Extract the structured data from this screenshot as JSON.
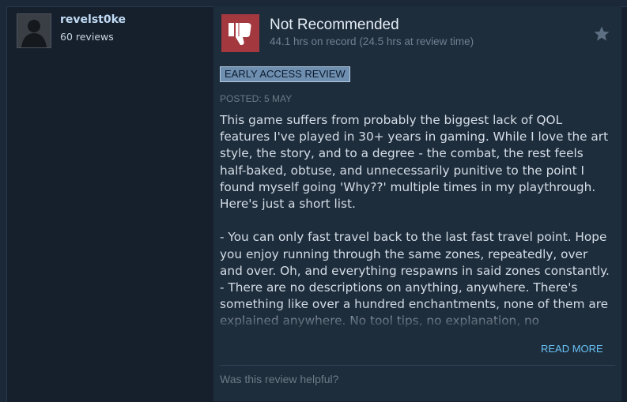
{
  "author": {
    "name": "revelst0ke",
    "reviews": "60 reviews"
  },
  "review": {
    "verdict": "Not Recommended",
    "hours": "44.1 hrs on record (24.5 hrs at review time)",
    "badge": "EARLY ACCESS REVIEW",
    "posted": "POSTED: 5 MAY",
    "body": "This game suffers from probably the biggest lack of QOL features I've played in 30+ years in gaming. While I love the art style, the story, and to a degree - the combat, the rest feels half-baked, obtuse, and unnecessarily punitive to the point I found myself going 'Why??' multiple times in my playthrough. Here's just a short list.\n\n- You can only fast travel back to the last fast travel point. Hope you enjoy running through the same zones, repeatedly, over and over. Oh, and everything respawns in said zones constantly.\n- There are no descriptions on anything, anywhere. There's something like over a hundred enchantments, none of them are explained anywhere. No tool tips, no explanation, no",
    "read_more": "READ MORE",
    "helpful_prompt": "Was this review helpful?"
  },
  "icons": {
    "verdict": "thumbs-down-icon",
    "award": "star-icon"
  },
  "colors": {
    "background": "#1b2838",
    "review_panel": "#1e2d3c",
    "thumb_bg": "#a3383f",
    "link": "#67c1f5",
    "badge_bg": "#6f8fb1"
  }
}
